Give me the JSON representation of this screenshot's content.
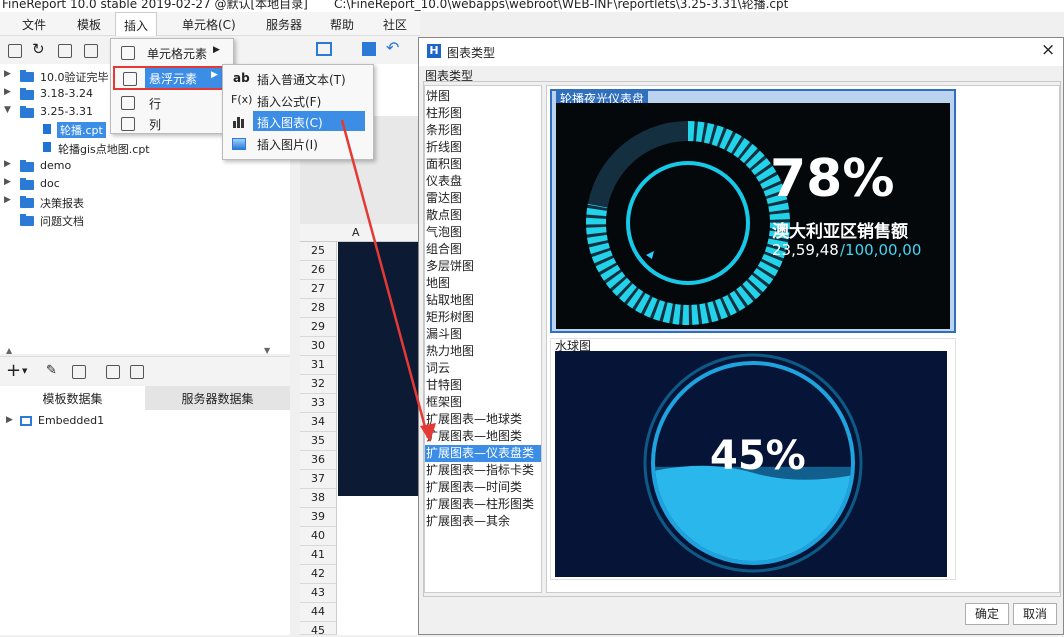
{
  "titlebar": {
    "app": "FineReport 10.0 stable 2019-02-27 @默认[本地目录]",
    "path": "C:\\FineReport_10.0\\webapps\\webroot\\WEB-INF\\reportlets\\3.25-3.31\\轮播.cpt"
  },
  "menubar": [
    "文件",
    "模板",
    "插入",
    "单元格(C)",
    "服务器",
    "帮助",
    "社区"
  ],
  "tree": [
    {
      "label": "10.0验证完毕",
      "type": "folder",
      "expanded": false
    },
    {
      "label": "3.18-3.24",
      "type": "folder",
      "expanded": false
    },
    {
      "label": "3.25-3.31",
      "type": "folder",
      "expanded": true
    },
    {
      "label": "轮播.cpt",
      "type": "file",
      "selected": true
    },
    {
      "label": "轮播gis点地图.cpt",
      "type": "file"
    },
    {
      "label": "demo",
      "type": "folder",
      "expanded": false
    },
    {
      "label": "doc",
      "type": "folder",
      "expanded": false
    },
    {
      "label": "决策报表",
      "type": "folder",
      "expanded": false
    },
    {
      "label": "问题文档",
      "type": "folder",
      "expanded": false
    }
  ],
  "datasets": {
    "tabs": [
      "模板数据集",
      "服务器数据集"
    ],
    "items": [
      "Embedded1"
    ]
  },
  "sheet": {
    "column_a": "A",
    "rows": [
      "25",
      "26",
      "27",
      "28",
      "29",
      "30",
      "31",
      "32",
      "33",
      "34",
      "35",
      "36",
      "37",
      "38",
      "39",
      "40",
      "41",
      "42",
      "43",
      "44",
      "45"
    ]
  },
  "insert_menu": {
    "items": [
      "单元格元素",
      "悬浮元素",
      "行",
      "列"
    ],
    "submenu": [
      "插入普通文本(T)",
      "插入公式(F)",
      "插入图表(C)",
      "插入图片(I)"
    ],
    "submenu_icons": [
      "ab",
      "F(x)"
    ]
  },
  "dialog": {
    "title": "图表类型",
    "section_label": "图表类型",
    "types": [
      "饼图",
      "柱形图",
      "条形图",
      "折线图",
      "面积图",
      "仪表盘",
      "雷达图",
      "散点图",
      "气泡图",
      "组合图",
      "多层饼图",
      "地图",
      "钻取地图",
      "矩形树图",
      "漏斗图",
      "热力地图",
      "词云",
      "甘特图",
      "框架图",
      "扩展图表—地球类",
      "扩展图表—地图类",
      "扩展图表—仪表盘类",
      "扩展图表—指标卡类",
      "扩展图表—时间类",
      "扩展图表—柱形图类",
      "扩展图表—其余"
    ],
    "selected_index": 21,
    "previews": [
      {
        "name": "轮播夜光仪表盘",
        "percent": "78%",
        "label": "澳大利亚区销售额",
        "value": "23,59,48",
        "total": "/100,00,00",
        "level": 0.78
      },
      {
        "name": "水球图",
        "percent": "45%",
        "level": 0.45
      }
    ],
    "ok": "确定",
    "cancel": "取消"
  }
}
